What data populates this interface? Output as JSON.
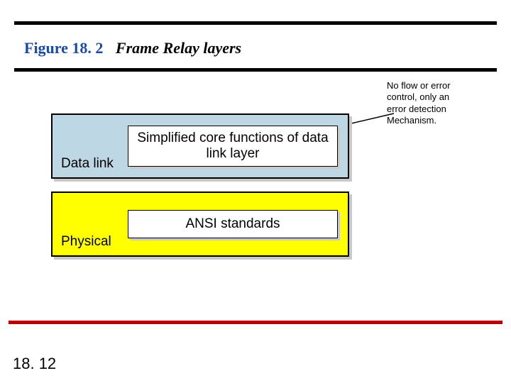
{
  "figure": {
    "number_label": "Figure 18. 2",
    "title": "Frame Relay layers"
  },
  "note": {
    "line1": "No flow or error",
    "line2": "control, only an",
    "line3": " error detection",
    "line4": "Mechanism."
  },
  "layers": {
    "datalink": {
      "label": "Data link",
      "inner": "Simplified core functions of data link layer"
    },
    "physical": {
      "label": "Physical",
      "inner": "ANSI standards"
    }
  },
  "page_number": "18. 12"
}
